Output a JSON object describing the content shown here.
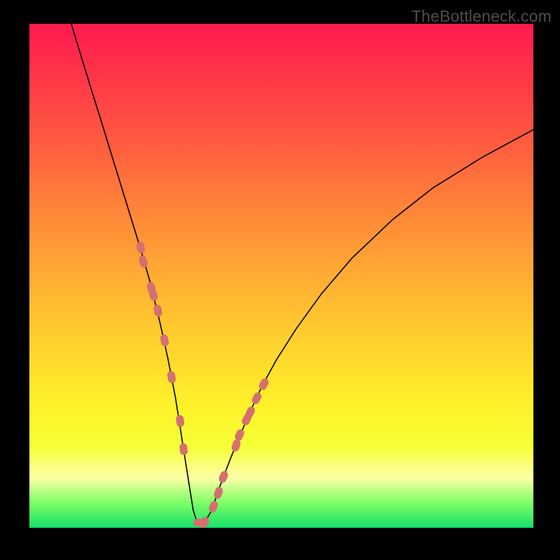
{
  "watermark": "TheBottleneck.com",
  "colors": {
    "frame": "#000000",
    "gradient_top": "#ff1a4d",
    "gradient_bottom": "#14e06a",
    "curve": "#000000",
    "marker": "#d47070"
  },
  "chart_data": {
    "type": "line",
    "title": "",
    "xlabel": "",
    "ylabel": "",
    "xlim": [
      0,
      100
    ],
    "ylim": [
      0,
      100
    ],
    "curve": {
      "x": [
        8.3,
        10,
        12,
        14,
        16,
        18,
        20,
        22,
        24,
        26,
        27.5,
        29,
        30.2,
        31.4,
        32.5,
        33.3,
        34.7,
        36.1,
        38,
        40,
        42,
        44,
        46,
        49,
        53,
        58,
        64,
        72,
        80,
        90,
        100
      ],
      "y": [
        100,
        94.4,
        87.9,
        81.5,
        75,
        68.5,
        62,
        55.5,
        48.6,
        40.3,
        33.5,
        25.7,
        18.1,
        10.4,
        3.5,
        1.0,
        1.0,
        3.3,
        8.8,
        14.0,
        18.8,
        23.5,
        27.8,
        33.3,
        39.6,
        46.5,
        53.5,
        61.1,
        67.4,
        73.6,
        79.0
      ]
    },
    "markers_left": {
      "x": [
        22.1,
        22.6,
        24.2,
        24.6,
        25.5,
        26.8,
        28.2,
        29.9,
        30.6
      ],
      "y": [
        55.6,
        52.8,
        47.6,
        46.2,
        43.1,
        37.2,
        29.9,
        21.2,
        15.6
      ]
    },
    "markers_right": {
      "x": [
        33.7,
        34.7,
        36.5,
        37.5,
        38.5,
        41.0,
        41.7,
        43.1,
        43.8,
        45.1,
        46.5
      ],
      "y": [
        1.04,
        1.04,
        4.17,
        6.94,
        10.1,
        16.3,
        18.4,
        21.5,
        22.9,
        25.7,
        28.5
      ]
    }
  }
}
